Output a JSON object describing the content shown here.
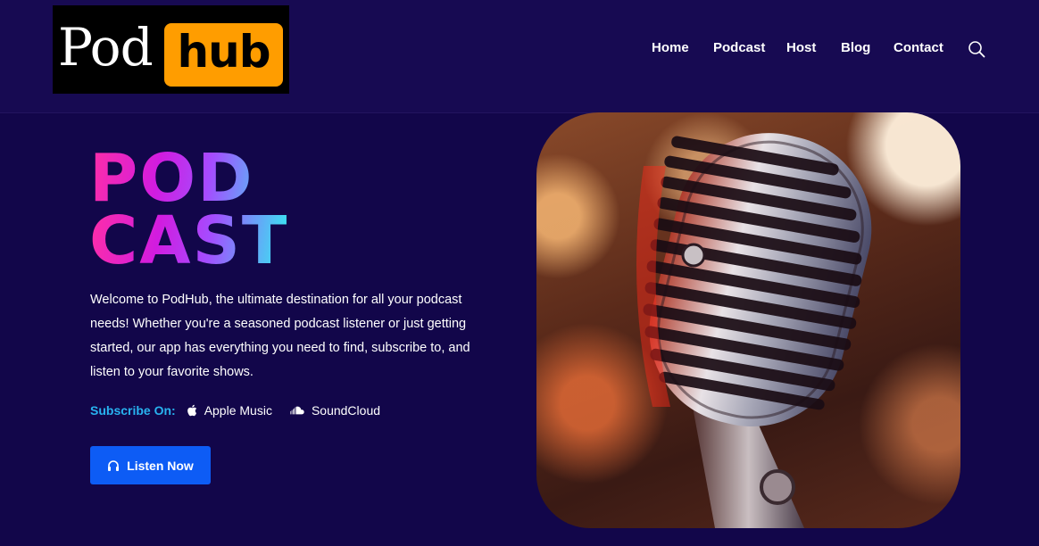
{
  "brand": {
    "logo_left": "Pod",
    "logo_right": "hub",
    "logo_right_bg": "#ff9d00"
  },
  "nav": {
    "items": [
      "Home",
      "Podcast",
      "Host",
      "Blog",
      "Contact"
    ],
    "search_icon": "search-icon"
  },
  "hero": {
    "title_line1": "POD",
    "title_line2": "CAST",
    "description": "Welcome to PodHub, the ultimate destination for all your podcast needs! Whether you're a seasoned podcast listener or just getting started, our app has everything you need to find, subscribe to, and listen to your favorite shows.",
    "subscribe_label": "Subscribe On:",
    "platforms": [
      {
        "label": "Apple Music",
        "icon": "apple-icon"
      },
      {
        "label": "SoundCloud",
        "icon": "soundcloud-icon"
      }
    ],
    "cta_label": "Listen Now",
    "cta_icon": "headphones-icon"
  },
  "colors": {
    "background": "#12064a",
    "header": "#170a52",
    "accent_blue": "#0d5cf5",
    "subscribe_label": "#28b3f0"
  }
}
